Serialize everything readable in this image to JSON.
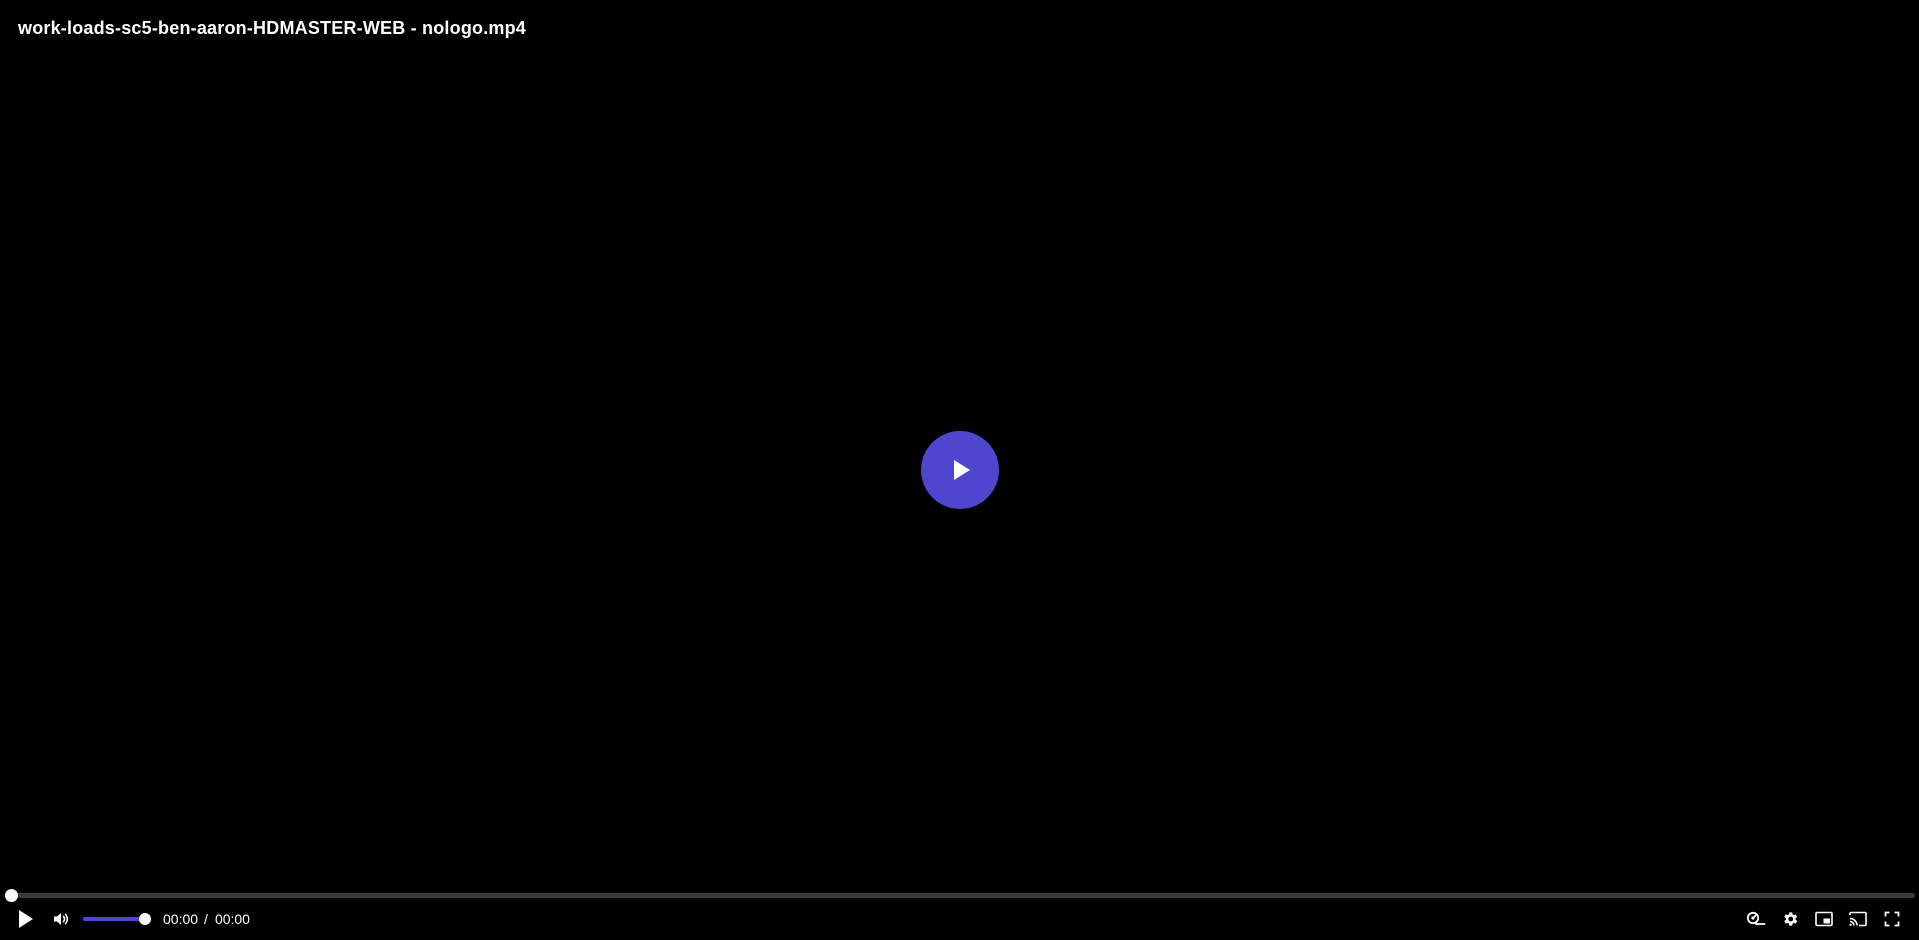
{
  "header": {
    "title": "work-loads-sc5-ben-aaron-HDMASTER-WEB - nologo.mp4"
  },
  "playback": {
    "current_time": "00:00",
    "separator": "/",
    "duration": "00:00",
    "progress_fraction": 0,
    "volume_fraction": 1
  },
  "icons": {
    "big_play": "play-icon",
    "play": "play-icon",
    "volume": "volume-icon",
    "speed": "playback-speed-icon",
    "settings": "gear-icon",
    "pip": "picture-in-picture-icon",
    "cast": "cast-icon",
    "fullscreen": "fullscreen-icon"
  },
  "colors": {
    "accent": "#4f46cf",
    "background": "#000000",
    "track": "#3a3a3a",
    "foreground": "#ffffff"
  }
}
